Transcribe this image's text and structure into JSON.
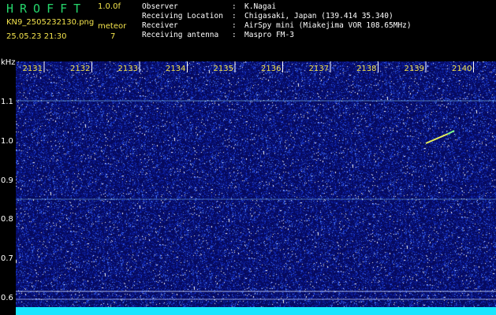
{
  "header": {
    "brand": "HROFFT",
    "version": "1.0.0f",
    "filename": "KN9_2505232130.png",
    "datetime": "25.05.23 21:30",
    "meteor_label": "meteor",
    "meteor_count": "7",
    "info": [
      {
        "key": "Observer",
        "value": "K.Nagai"
      },
      {
        "key": "Receiving Location",
        "value": "Chigasaki, Japan (139.414 35.340)"
      },
      {
        "key": "Receiver",
        "value": "AirSpy mini (Miakejima VOR 108.65MHz)"
      },
      {
        "key": "Receiving antenna",
        "value": "Maspro FM-3"
      }
    ]
  },
  "axis": {
    "unit": "kHz",
    "y_ticks": [
      "1.1",
      "1.0",
      "0.9",
      "0.8",
      "0.7",
      "0.6"
    ],
    "time_ticks": [
      "2131",
      "2132",
      "2133",
      "2134",
      "2135",
      "2136",
      "2137",
      "2138",
      "2139",
      "2140"
    ]
  },
  "colors": {
    "background": "#060a5e",
    "label_yellow": "#f3e34c",
    "brand_green": "#25d56b",
    "baseline_cyan": "#18e6ff"
  }
}
